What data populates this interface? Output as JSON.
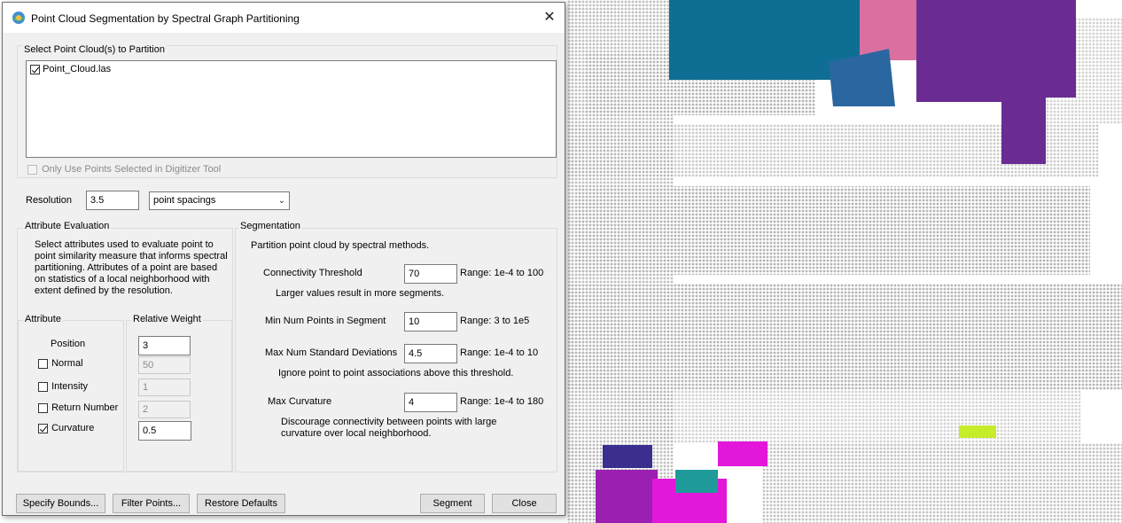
{
  "dialog": {
    "title": "Point Cloud Segmentation by Spectral Graph Partitioning",
    "close_glyph": "✕",
    "select_group_label": "Select Point Cloud(s) to Partition",
    "point_clouds": [
      {
        "name": "Point_Cloud.las",
        "checked": true
      }
    ],
    "only_selected_label": "Only Use Points Selected in Digitizer Tool",
    "resolution_label": "Resolution",
    "resolution_value": "3.5",
    "resolution_unit": "point spacings",
    "attribute_eval": {
      "group_label": "Attribute Evaluation",
      "description": "Select attributes used to evaluate point to point similarity measure that informs spectral partitioning. Attributes of a point are based on statistics of a local neighborhood with extent defined by the resolution.",
      "attribute_header": "Attribute",
      "weight_header": "Relative Weight",
      "attributes": [
        {
          "label": "Position",
          "has_checkbox": false,
          "checked": true,
          "weight": "3",
          "enabled": true
        },
        {
          "label": "Normal",
          "has_checkbox": true,
          "checked": false,
          "weight": "50",
          "enabled": false
        },
        {
          "label": "Intensity",
          "has_checkbox": true,
          "checked": false,
          "weight": "1",
          "enabled": false
        },
        {
          "label": "Return Number",
          "has_checkbox": true,
          "checked": false,
          "weight": "2",
          "enabled": false
        },
        {
          "label": "Curvature",
          "has_checkbox": true,
          "checked": true,
          "weight": "0.5",
          "enabled": true
        }
      ]
    },
    "segmentation": {
      "group_label": "Segmentation",
      "description": "Partition point cloud by spectral methods.",
      "connectivity_label": "Connectivity Threshold",
      "connectivity_value": "70",
      "connectivity_range": "Range: 1e-4 to 100",
      "connectivity_hint": "Larger values result in more segments.",
      "min_points_label": "Min Num Points in Segment",
      "min_points_value": "10",
      "min_points_range": "Range: 3 to 1e5",
      "max_std_label": "Max Num Standard Deviations",
      "max_std_value": "4.5",
      "max_std_range": "Range: 1e-4 to 10",
      "max_std_hint": "Ignore point to point associations above this threshold.",
      "max_curv_label": "Max Curvature",
      "max_curv_value": "4",
      "max_curv_range": "Range: 1e-4 to 180",
      "max_curv_hint": "Discourage connectivity between points with large curvature over local neighborhood."
    },
    "buttons": {
      "specify_bounds": "Specify Bounds...",
      "filter_points": "Filter Points...",
      "restore_defaults": "Restore Defaults",
      "segment": "Segment",
      "close": "Close"
    }
  },
  "background": {
    "description_colors": {
      "teal": "#0e6e93",
      "pink": "#d9709f",
      "purple": "#6a2c93",
      "blue": "#2a66a0",
      "magenta": "#e317d9",
      "gray": "#b4b4b4",
      "lime": "#c6ec2a"
    }
  }
}
